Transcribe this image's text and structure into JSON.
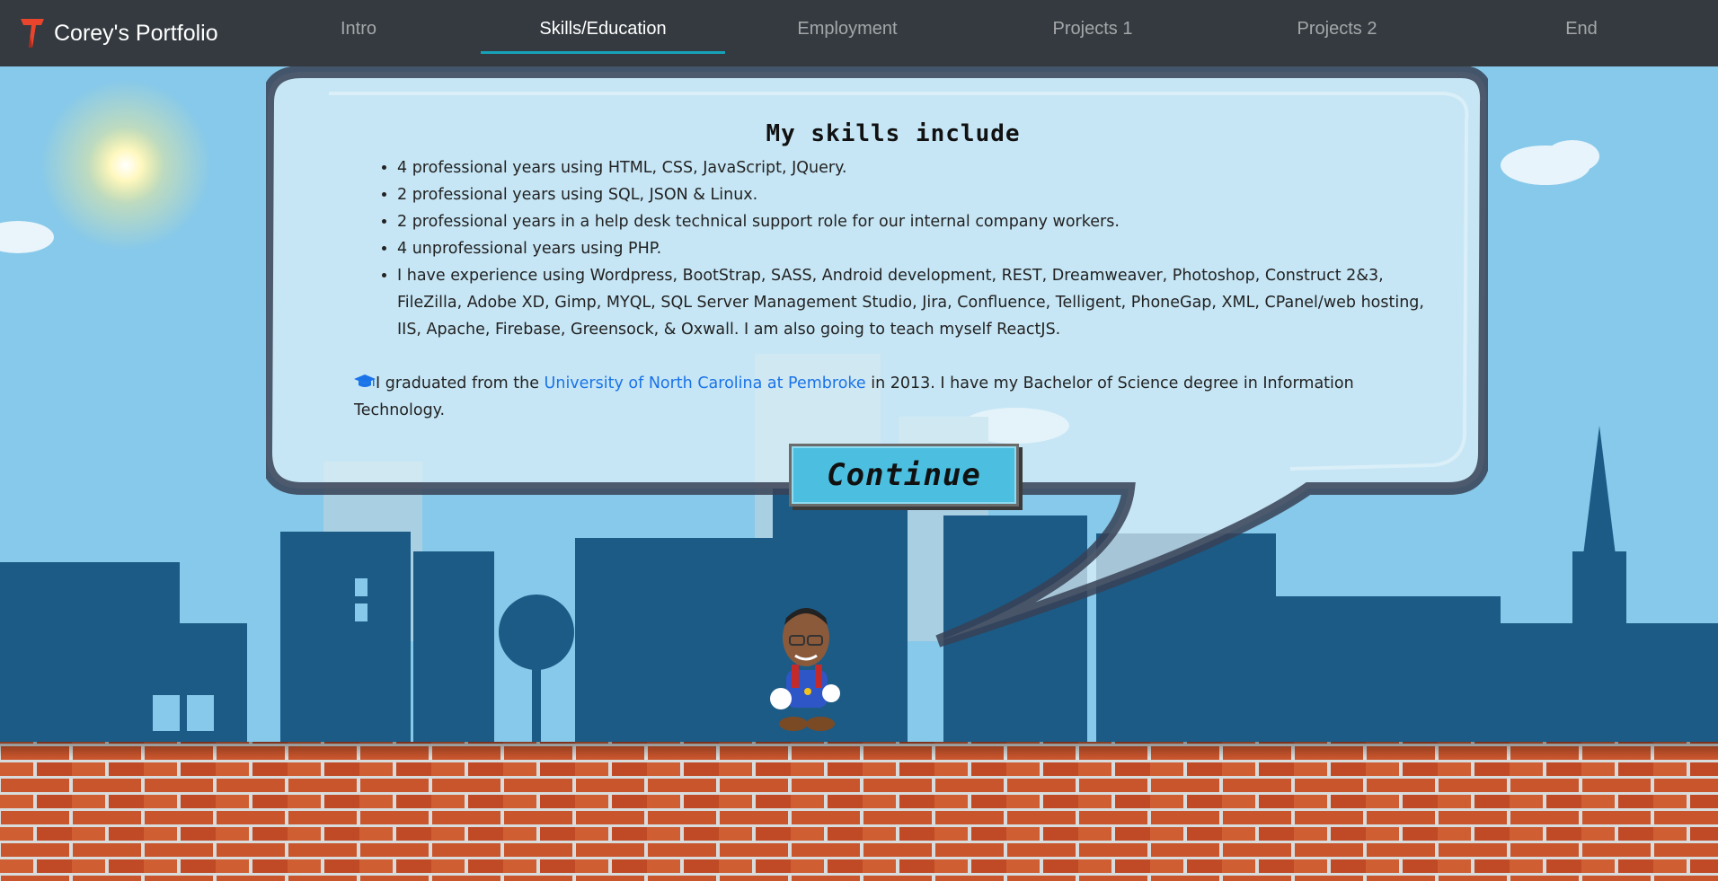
{
  "brand": {
    "name": "Corey's Portfolio",
    "logo_icon": "t-logo-icon"
  },
  "nav": {
    "items": [
      {
        "label": "Intro"
      },
      {
        "label": "Skills/Education"
      },
      {
        "label": "Employment"
      },
      {
        "label": "Projects 1"
      },
      {
        "label": "Projects 2"
      },
      {
        "label": "End"
      }
    ],
    "active_index": 1,
    "accent_color": "#17a2b8"
  },
  "skills": {
    "title": "My skills include",
    "items": [
      "4 professional years using HTML, CSS, JavaScript, JQuery.",
      "2 professional years using SQL, JSON & Linux.",
      "2 professional years in a help desk technical support role for our internal company workers.",
      "4 unprofessional years using PHP.",
      "I have experience using Wordpress, BootStrap, SASS, Android development, REST, Dreamweaver, Photoshop, Construct 2&3, FileZilla, Adobe XD, Gimp, MYQL, SQL Server Management Studio, Jira, Confluence, Telligent, PhoneGap, XML, CPanel/web hosting, IIS, Apache, Firebase, Greensock, & Oxwall. I am also going to teach myself ReactJS."
    ]
  },
  "education": {
    "icon": "graduation-cap-icon",
    "prefix": "I graduated from the ",
    "link_text": "University of North Carolina at Pembroke",
    "suffix": " in 2013. I have my Bachelor of Science degree in Information Technology."
  },
  "continue_label": "Continue",
  "colors": {
    "sky": "#87c9ea",
    "city": "#1a5a86",
    "brick": "#c9542c",
    "link": "#1a73e8"
  }
}
